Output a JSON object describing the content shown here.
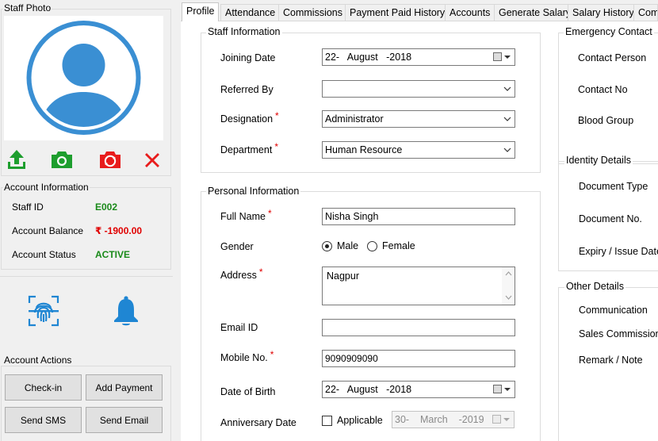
{
  "left": {
    "photo_title": "Staff Photo",
    "account_title": "Account Information",
    "staff_id_label": "Staff ID",
    "staff_id": "E002",
    "balance_label": "Account Balance",
    "balance": "₹ -1900.00",
    "status_label": "Account Status",
    "status": "ACTIVE",
    "actions_title": "Account Actions",
    "btn_checkin": "Check-in",
    "btn_add_payment": "Add Payment",
    "btn_send_sms": "Send SMS",
    "btn_send_email": "Send Email"
  },
  "tabs": [
    "Profile",
    "Attendance",
    "Commissions",
    "Payment Paid History",
    "Accounts",
    "Generate Salary",
    "Salary History",
    "Com"
  ],
  "staff_info": {
    "title": "Staff Information",
    "joining_label": "Joining  Date",
    "joining_value": "22-   August   -2018",
    "referred_label": "Referred By",
    "referred_value": "",
    "designation_label": "Designation",
    "designation_value": "Administrator",
    "department_label": "Department",
    "department_value": "Human Resource",
    "required": "*"
  },
  "personal_info": {
    "title": "Personal Information",
    "fullname_label": "Full Name",
    "fullname_value": "Nisha Singh",
    "gender_label": "Gender",
    "gender_male": "Male",
    "gender_female": "Female",
    "address_label": "Address",
    "address_value": "Nagpur",
    "email_label": "Email ID",
    "email_value": "",
    "mobile_label": "Mobile No.",
    "mobile_value": "9090909090",
    "dob_label": "Date of Birth",
    "dob_value": "22-   August   -2018",
    "anniv_label": "Anniversary Date",
    "anniv_applicable": "Applicable",
    "anniv_value": "30-    March    -2019"
  },
  "emergency": {
    "title": "Emergency Contact",
    "contact_person": "Contact Person",
    "contact_no": "Contact No",
    "blood_group": "Blood Group"
  },
  "identity": {
    "title": "Identity Details",
    "doc_type": "Document Type",
    "doc_no": "Document No.",
    "expiry": "Expiry / Issue Date"
  },
  "other": {
    "title": "Other Details",
    "communication": "Communication",
    "sales_commission": "Sales Commission",
    "remark": "Remark / Note"
  },
  "colors": {
    "photo_blue": "#3a8fd3",
    "upload_green": "#1e9e2e",
    "camera_red": "#e81c1c",
    "id_green": "#1a8a1a",
    "balance_red": "#e00000",
    "icon_blue": "#1f86d3"
  }
}
